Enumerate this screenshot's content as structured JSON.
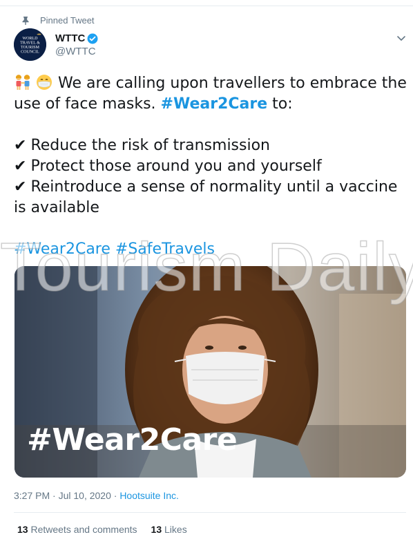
{
  "pinned": {
    "label": "Pinned Tweet"
  },
  "account": {
    "name": "WTTC",
    "handle": "@WTTC",
    "avatar_text": "WORLD TRAVEL & TOURISM COUNCIL"
  },
  "tweet": {
    "line1": "We are calling upon travellers to embrace the",
    "line2_prefix": "use of face masks. ",
    "line2_hashtag": "#Wear2Care",
    "line2_suffix": " to:",
    "check_symbol": "✔",
    "bullets": [
      "Reduce the risk of transmission",
      "Protect those around you and yourself",
      "Reintroduce a sense of normality until a vaccine is available"
    ],
    "hashtags": [
      "#Wear2Care",
      "#SafeTravels"
    ]
  },
  "media": {
    "overlay_text": "#Wear2Care"
  },
  "watermark": {
    "text": "Tourism Daily"
  },
  "meta": {
    "time": "3:27 PM · Jul 10, 2020 · ",
    "source": "Hootsuite Inc."
  },
  "stats": {
    "retweets_count": "13",
    "retweets_label": " Retweets and comments",
    "likes_count": "13",
    "likes_label": " Likes"
  },
  "colors": {
    "link": "#1b95e0",
    "secondary": "#657786",
    "text": "#14171a"
  },
  "icons": {
    "pin": "pin-icon",
    "verified": "verified-badge-icon",
    "caret": "chevron-down-icon",
    "emoji1": "people-holding-hands-emoji",
    "emoji2": "face-with-medical-mask-emoji"
  }
}
